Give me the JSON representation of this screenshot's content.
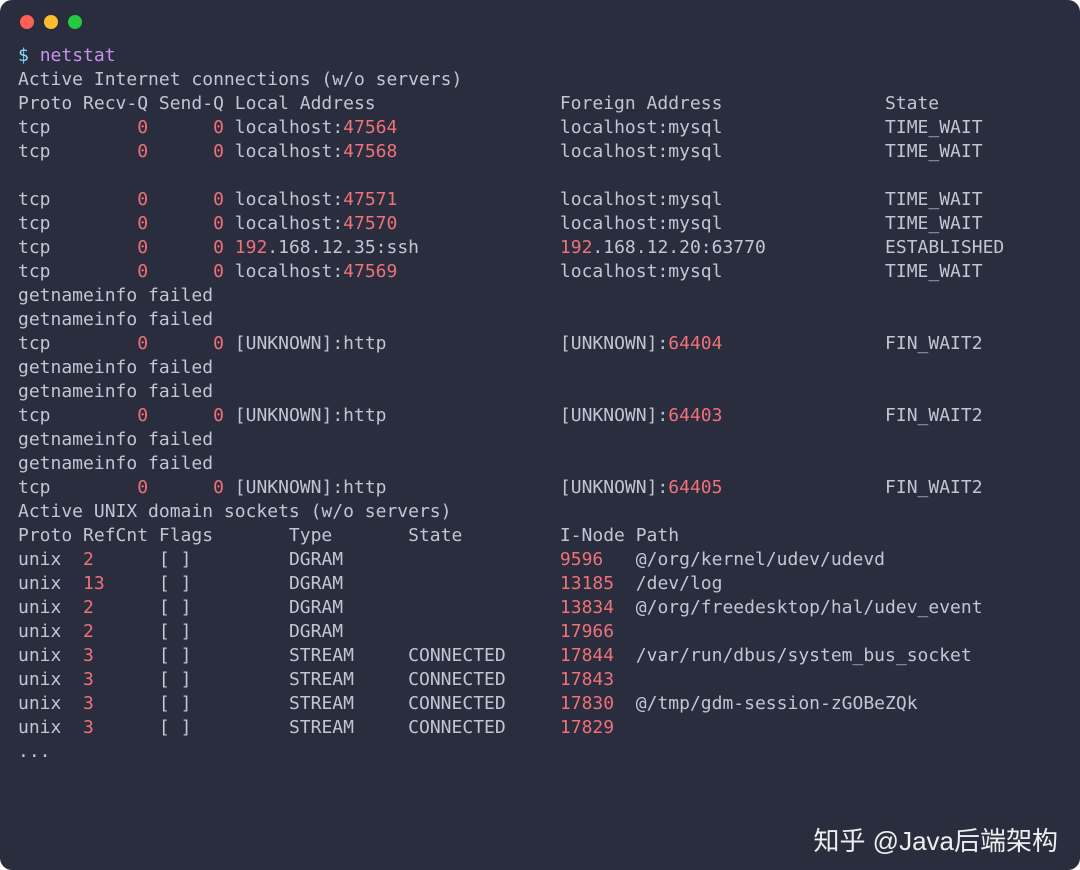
{
  "window": {
    "traffic_lights": [
      "close",
      "minimize",
      "maximize"
    ]
  },
  "prompt": {
    "symbol": "$",
    "command": "netstat"
  },
  "inet": {
    "heading": "Active Internet connections (w/o servers)",
    "columns": {
      "proto": "Proto",
      "recvq": "Recv-Q",
      "sendq": "Send-Q",
      "local": "Local Address",
      "foreign": "Foreign Address",
      "state": "State"
    },
    "lines": [
      {
        "type": "row",
        "proto": "tcp",
        "recvq": "0",
        "sendq": "0",
        "local": {
          "pre": "localhost:",
          "num": "47564",
          "post": ""
        },
        "foreign": {
          "pre": "localhost:mysql",
          "num": "",
          "post": ""
        },
        "state": "TIME_WAIT"
      },
      {
        "type": "row",
        "proto": "tcp",
        "recvq": "0",
        "sendq": "0",
        "local": {
          "pre": "localhost:",
          "num": "47568",
          "post": ""
        },
        "foreign": {
          "pre": "localhost:mysql",
          "num": "",
          "post": ""
        },
        "state": "TIME_WAIT"
      },
      {
        "type": "blank"
      },
      {
        "type": "row",
        "proto": "tcp",
        "recvq": "0",
        "sendq": "0",
        "local": {
          "pre": "localhost:",
          "num": "47571",
          "post": ""
        },
        "foreign": {
          "pre": "localhost:mysql",
          "num": "",
          "post": ""
        },
        "state": "TIME_WAIT"
      },
      {
        "type": "row",
        "proto": "tcp",
        "recvq": "0",
        "sendq": "0",
        "local": {
          "pre": "localhost:",
          "num": "47570",
          "post": ""
        },
        "foreign": {
          "pre": "localhost:mysql",
          "num": "",
          "post": ""
        },
        "state": "TIME_WAIT"
      },
      {
        "type": "row",
        "proto": "tcp",
        "recvq": "0",
        "sendq": "0",
        "local": {
          "pre": "",
          "num": "192",
          "post": ".168.12.35:ssh"
        },
        "foreign": {
          "pre": "",
          "num": "192",
          "post": ".168.12.20:63770"
        },
        "state": "ESTABLISHED"
      },
      {
        "type": "row",
        "proto": "tcp",
        "recvq": "0",
        "sendq": "0",
        "local": {
          "pre": "localhost:",
          "num": "47569",
          "post": ""
        },
        "foreign": {
          "pre": "localhost:mysql",
          "num": "",
          "post": ""
        },
        "state": "TIME_WAIT"
      },
      {
        "type": "msg",
        "text": "getnameinfo failed"
      },
      {
        "type": "msg",
        "text": "getnameinfo failed"
      },
      {
        "type": "row",
        "proto": "tcp",
        "recvq": "0",
        "sendq": "0",
        "local": {
          "pre": "[UNKNOWN]:http",
          "num": "",
          "post": ""
        },
        "foreign": {
          "pre": "[UNKNOWN]:",
          "num": "64404",
          "post": ""
        },
        "state": "FIN_WAIT2"
      },
      {
        "type": "msg",
        "text": "getnameinfo failed"
      },
      {
        "type": "msg",
        "text": "getnameinfo failed"
      },
      {
        "type": "row",
        "proto": "tcp",
        "recvq": "0",
        "sendq": "0",
        "local": {
          "pre": "[UNKNOWN]:http",
          "num": "",
          "post": ""
        },
        "foreign": {
          "pre": "[UNKNOWN]:",
          "num": "64403",
          "post": ""
        },
        "state": "FIN_WAIT2"
      },
      {
        "type": "msg",
        "text": "getnameinfo failed"
      },
      {
        "type": "msg",
        "text": "getnameinfo failed"
      },
      {
        "type": "row",
        "proto": "tcp",
        "recvq": "0",
        "sendq": "0",
        "local": {
          "pre": "[UNKNOWN]:http",
          "num": "",
          "post": ""
        },
        "foreign": {
          "pre": "[UNKNOWN]:",
          "num": "64405",
          "post": ""
        },
        "state": "FIN_WAIT2"
      }
    ]
  },
  "unix": {
    "heading": "Active UNIX domain sockets (w/o servers)",
    "columns": {
      "proto": "Proto",
      "refcnt": "RefCnt",
      "flags": "Flags",
      "type": "Type",
      "state": "State",
      "inode": "I-Node",
      "path": "Path"
    },
    "rows": [
      {
        "proto": "unix",
        "refcnt": "2",
        "flags": "[ ]",
        "type": "DGRAM",
        "state": "",
        "inode": "9596",
        "path": "@/org/kernel/udev/udevd"
      },
      {
        "proto": "unix",
        "refcnt": "13",
        "flags": "[ ]",
        "type": "DGRAM",
        "state": "",
        "inode": "13185",
        "path": "/dev/log"
      },
      {
        "proto": "unix",
        "refcnt": "2",
        "flags": "[ ]",
        "type": "DGRAM",
        "state": "",
        "inode": "13834",
        "path": "@/org/freedesktop/hal/udev_event"
      },
      {
        "proto": "unix",
        "refcnt": "2",
        "flags": "[ ]",
        "type": "DGRAM",
        "state": "",
        "inode": "17966",
        "path": ""
      },
      {
        "proto": "unix",
        "refcnt": "3",
        "flags": "[ ]",
        "type": "STREAM",
        "state": "CONNECTED",
        "inode": "17844",
        "path": "/var/run/dbus/system_bus_socket"
      },
      {
        "proto": "unix",
        "refcnt": "3",
        "flags": "[ ]",
        "type": "STREAM",
        "state": "CONNECTED",
        "inode": "17843",
        "path": ""
      },
      {
        "proto": "unix",
        "refcnt": "3",
        "flags": "[ ]",
        "type": "STREAM",
        "state": "CONNECTED",
        "inode": "17830",
        "path": "@/tmp/gdm-session-zGOBeZQk"
      },
      {
        "proto": "unix",
        "refcnt": "3",
        "flags": "[ ]",
        "type": "STREAM",
        "state": "CONNECTED",
        "inode": "17829",
        "path": ""
      }
    ],
    "trail": "..."
  },
  "watermark": "知乎 @Java后端架构"
}
